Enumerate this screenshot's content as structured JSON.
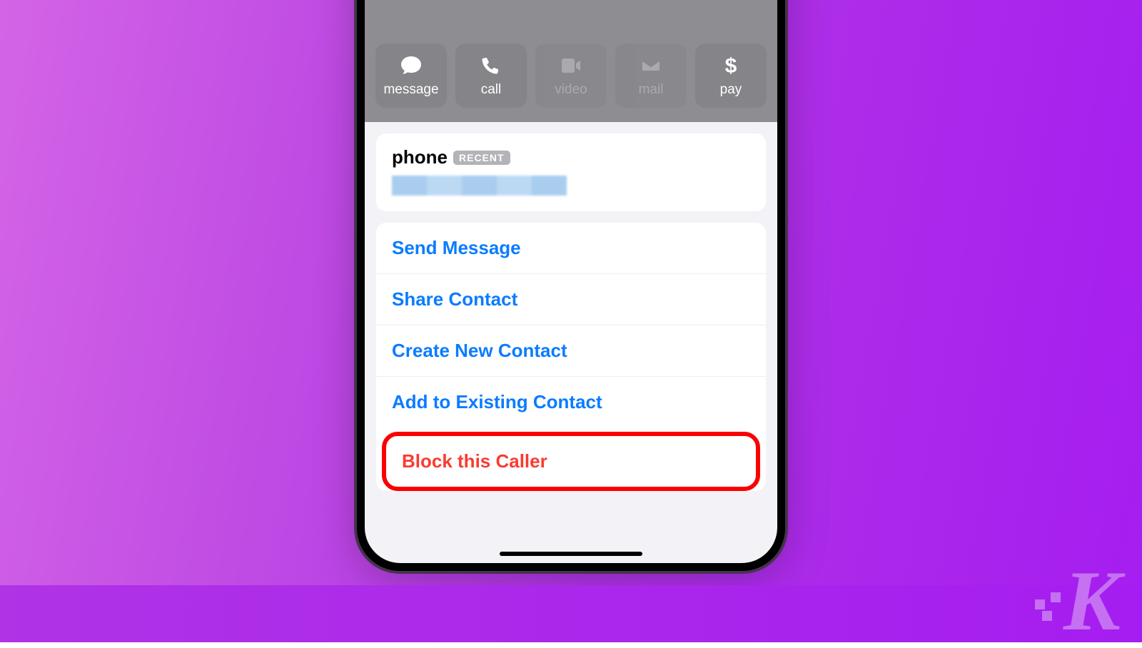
{
  "actions": [
    {
      "key": "message",
      "label": "message",
      "enabled": true
    },
    {
      "key": "call",
      "label": "call",
      "enabled": true
    },
    {
      "key": "video",
      "label": "video",
      "enabled": false
    },
    {
      "key": "mail",
      "label": "mail",
      "enabled": false
    },
    {
      "key": "pay",
      "label": "pay",
      "enabled": true
    }
  ],
  "phone_section": {
    "label": "phone",
    "recent_badge": "RECENT"
  },
  "options": {
    "send_message": "Send Message",
    "share_contact": "Share Contact",
    "create_new_contact": "Create New Contact",
    "add_existing": "Add to Existing Contact",
    "block": "Block this Caller"
  },
  "watermark": "K"
}
